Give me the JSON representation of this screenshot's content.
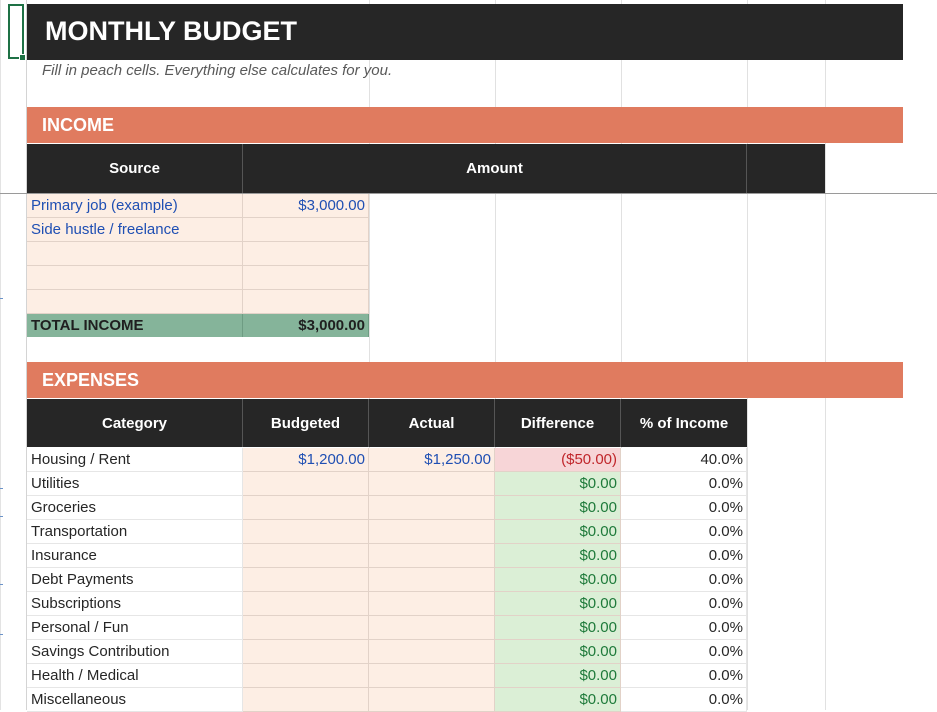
{
  "title": "MONTHLY BUDGET",
  "subtitle": "Fill in peach cells. Everything else calculates for you.",
  "income": {
    "section_label": "INCOME",
    "headers": {
      "source": "Source",
      "amount": "Amount"
    },
    "rows": [
      {
        "source": "Primary job (example)",
        "amount": "$3,000.00"
      },
      {
        "source": "Side hustle / freelance",
        "amount": ""
      },
      {
        "source": "",
        "amount": ""
      },
      {
        "source": "",
        "amount": ""
      },
      {
        "source": "",
        "amount": ""
      }
    ],
    "total_label": "TOTAL INCOME",
    "total_value": "$3,000.00"
  },
  "expenses": {
    "section_label": "EXPENSES",
    "headers": {
      "category": "Category",
      "budgeted": "Budgeted",
      "actual": "Actual",
      "difference": "Difference",
      "pct": "% of Income"
    },
    "rows": [
      {
        "category": "Housing / Rent",
        "budgeted": "$1,200.00",
        "actual": "$1,250.00",
        "difference": "($50.00)",
        "pct": "40.0%",
        "over": true
      },
      {
        "category": "Utilities",
        "budgeted": "",
        "actual": "",
        "difference": "$0.00",
        "pct": "0.0%",
        "over": false
      },
      {
        "category": "Groceries",
        "budgeted": "",
        "actual": "",
        "difference": "$0.00",
        "pct": "0.0%",
        "over": false
      },
      {
        "category": "Transportation",
        "budgeted": "",
        "actual": "",
        "difference": "$0.00",
        "pct": "0.0%",
        "over": false
      },
      {
        "category": "Insurance",
        "budgeted": "",
        "actual": "",
        "difference": "$0.00",
        "pct": "0.0%",
        "over": false
      },
      {
        "category": "Debt Payments",
        "budgeted": "",
        "actual": "",
        "difference": "$0.00",
        "pct": "0.0%",
        "over": false
      },
      {
        "category": "Subscriptions",
        "budgeted": "",
        "actual": "",
        "difference": "$0.00",
        "pct": "0.0%",
        "over": false
      },
      {
        "category": "Personal / Fun",
        "budgeted": "",
        "actual": "",
        "difference": "$0.00",
        "pct": "0.0%",
        "over": false
      },
      {
        "category": "Savings Contribution",
        "budgeted": "",
        "actual": "",
        "difference": "$0.00",
        "pct": "0.0%",
        "over": false
      },
      {
        "category": "Health / Medical",
        "budgeted": "",
        "actual": "",
        "difference": "$0.00",
        "pct": "0.0%",
        "over": false
      },
      {
        "category": "Miscellaneous",
        "budgeted": "",
        "actual": "",
        "difference": "$0.00",
        "pct": "0.0%",
        "over": false
      }
    ]
  },
  "colors": {
    "title_bg": "#262626",
    "section_bg": "#e07b5f",
    "input_peach": "#fdeee4",
    "calc_green": "#dbefd6",
    "over_pink": "#f7d5d7",
    "total_green": "#85b49a",
    "input_text_blue": "#1f4fb3"
  }
}
